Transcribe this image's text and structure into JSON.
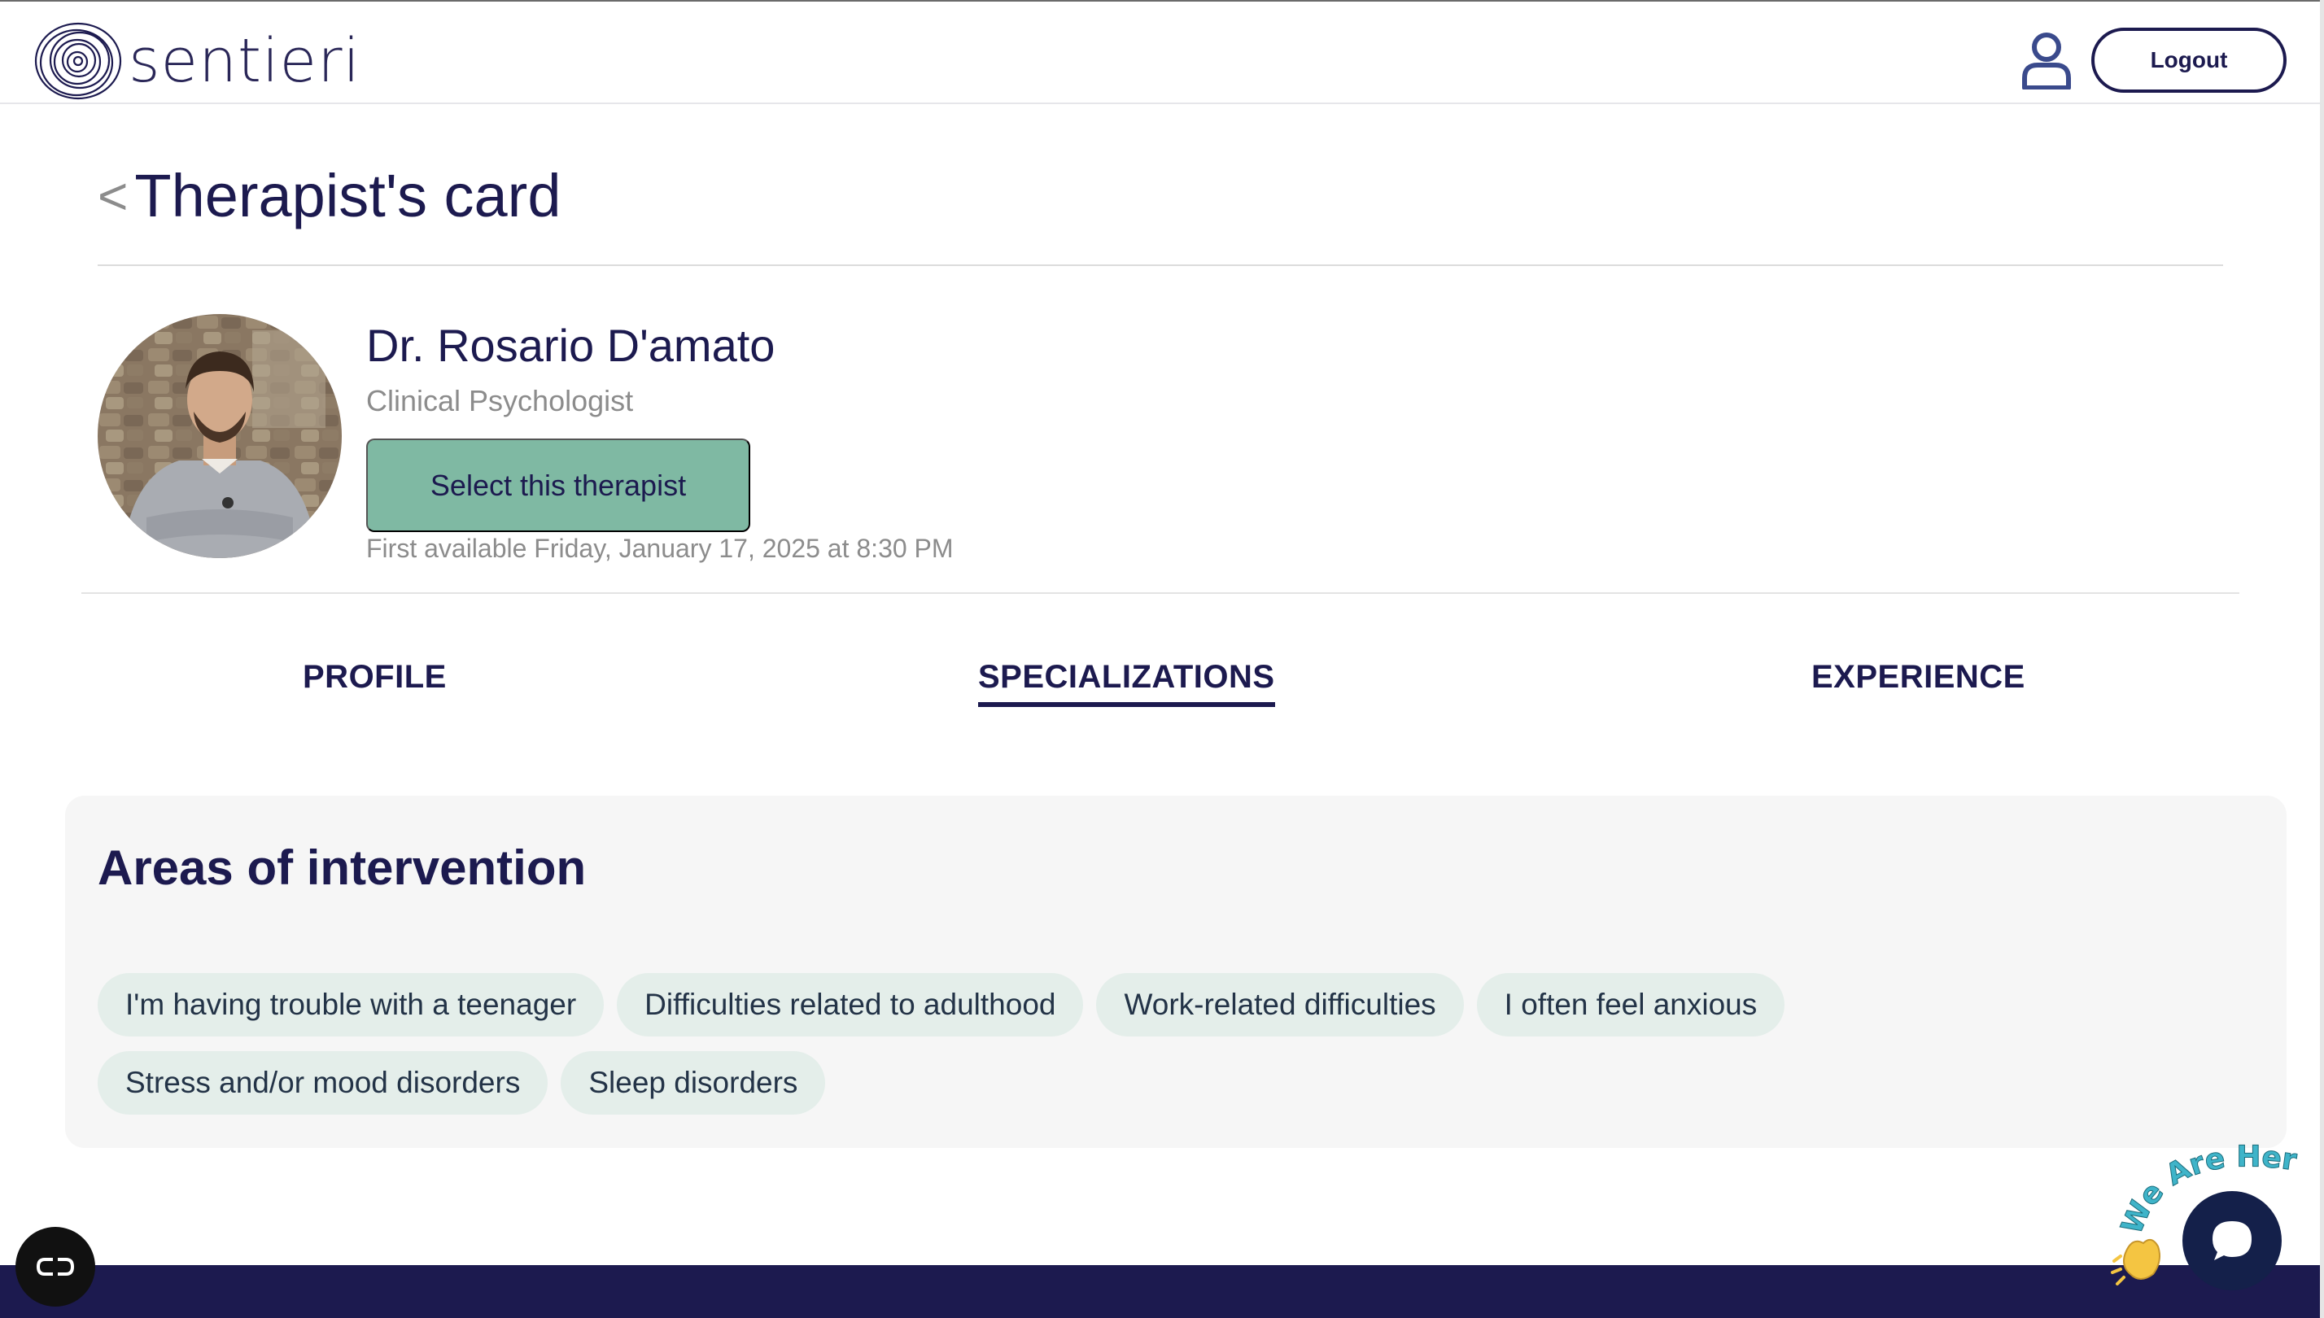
{
  "header": {
    "brand_name": "sentieri",
    "logout_label": "Logout",
    "user_icon": "user-icon"
  },
  "page": {
    "back_symbol": "<",
    "title": "Therapist's card"
  },
  "therapist": {
    "name": "Dr. Rosario D'amato",
    "role": "Clinical Psychologist",
    "select_label": "Select this therapist",
    "availability": "First available Friday, January 17, 2025 at 8:30 PM"
  },
  "tabs": [
    {
      "label": "PROFILE",
      "active": false
    },
    {
      "label": "SPECIALIZATIONS",
      "active": true
    },
    {
      "label": "EXPERIENCE",
      "active": false
    }
  ],
  "panel": {
    "title": "Areas of intervention",
    "chips": [
      "I'm having trouble with a teenager",
      "Difficulties related to adulthood",
      "Work-related difficulties",
      "I often feel anxious",
      "Stress and/or mood disorders",
      "Sleep disorders"
    ]
  },
  "chat_widget": {
    "badge_text": "We Are Here!",
    "icon": "chat-bubble-icon"
  },
  "accessibility": {
    "icon": "accessibility-icon"
  },
  "colors": {
    "navy": "#1c1a4f",
    "accent_green": "#7fb9a3",
    "chip_bg": "#e4eeea",
    "panel_bg": "#f6f6f6",
    "badge_teal": "#3fb4c9",
    "muted_text": "#8c8c8c"
  }
}
